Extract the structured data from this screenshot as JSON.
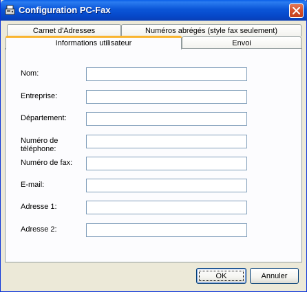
{
  "window": {
    "title": "Configuration PC-Fax",
    "icon": "pc-fax-app-icon",
    "close_icon": "close-icon"
  },
  "tabs": {
    "back_row": [
      {
        "label": "Carnet d'Adresses"
      },
      {
        "label": "Numéros abrégés (style fax seulement)"
      }
    ],
    "front_row": [
      {
        "label": "Informations utilisateur",
        "active": true
      },
      {
        "label": "Envoi",
        "active": false
      }
    ]
  },
  "form": {
    "fields": [
      {
        "label": "Nom:",
        "value": ""
      },
      {
        "label": "Entreprise:",
        "value": ""
      },
      {
        "label": "Département:",
        "value": ""
      },
      {
        "label": "Numéro de téléphone:",
        "value": ""
      },
      {
        "label": "Numéro de fax:",
        "value": ""
      },
      {
        "label": "E-mail:",
        "value": ""
      },
      {
        "label": "Adresse 1:",
        "value": ""
      },
      {
        "label": "Adresse 2:",
        "value": ""
      }
    ]
  },
  "buttons": {
    "ok": "OK",
    "cancel": "Annuler"
  },
  "colors": {
    "titlebar": "#0a5fe8",
    "dialog_bg": "#ece9d8",
    "panel_bg": "#fcfcfe",
    "active_tab_accent": "#f9b42e",
    "input_border": "#7f9db9"
  }
}
